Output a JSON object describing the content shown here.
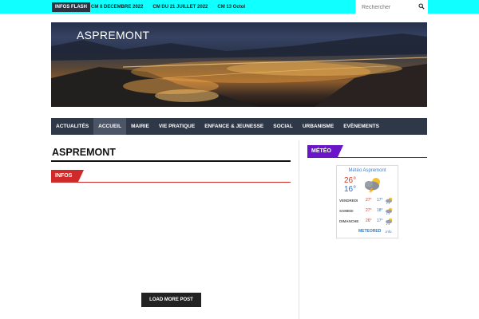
{
  "flash": {
    "badge": "INFOS FLASH",
    "items": [
      "CM 8 DECEMBRE 2022",
      "CM DU 21 JUILLET 2022",
      "CM 13 Octol"
    ]
  },
  "search": {
    "placeholder": "Rechercher",
    "icon": "search-icon"
  },
  "banner": {
    "title": "ASPREMONT"
  },
  "nav": {
    "items": [
      {
        "label": "ACTUALITÉS",
        "active": false
      },
      {
        "label": "ACCUEIL",
        "active": true
      },
      {
        "label": "MAIRIE",
        "active": false
      },
      {
        "label": "VIE PRATIQUE",
        "active": false
      },
      {
        "label": "ENFANCE & JEUNESSE",
        "active": false
      },
      {
        "label": "SOCIAL",
        "active": false
      },
      {
        "label": "URBANISME",
        "active": false
      },
      {
        "label": "EVÈNEMENTS",
        "active": false
      }
    ]
  },
  "main": {
    "title": "ASPREMONT",
    "section": "INFOS",
    "load_more": "LOAD MORE POST"
  },
  "sidebar": {
    "section": "MÉTÉO",
    "widget": {
      "title": "Météo Aspremont",
      "today_max": "26°",
      "today_min": "16°",
      "today_icon": "storm-cloud-sun-icon",
      "forecast": [
        {
          "day": "VENDREDI",
          "max": "27°",
          "min": "17°",
          "icon": "sun-cloud-rain-icon"
        },
        {
          "day": "SAMEDI",
          "max": "27°",
          "min": "18°",
          "icon": "sun-cloud-rain-icon"
        },
        {
          "day": "DIMANCHE",
          "max": "26°",
          "min": "17°",
          "icon": "sun-cloud-rain-icon"
        }
      ],
      "brand": "METEORED",
      "brand_tld": ".info"
    }
  },
  "colors": {
    "topbar": "#10ffff",
    "nav": "#2f3846",
    "infos_accent": "#cf2a2a",
    "meteo_accent": "#6b15c9"
  }
}
